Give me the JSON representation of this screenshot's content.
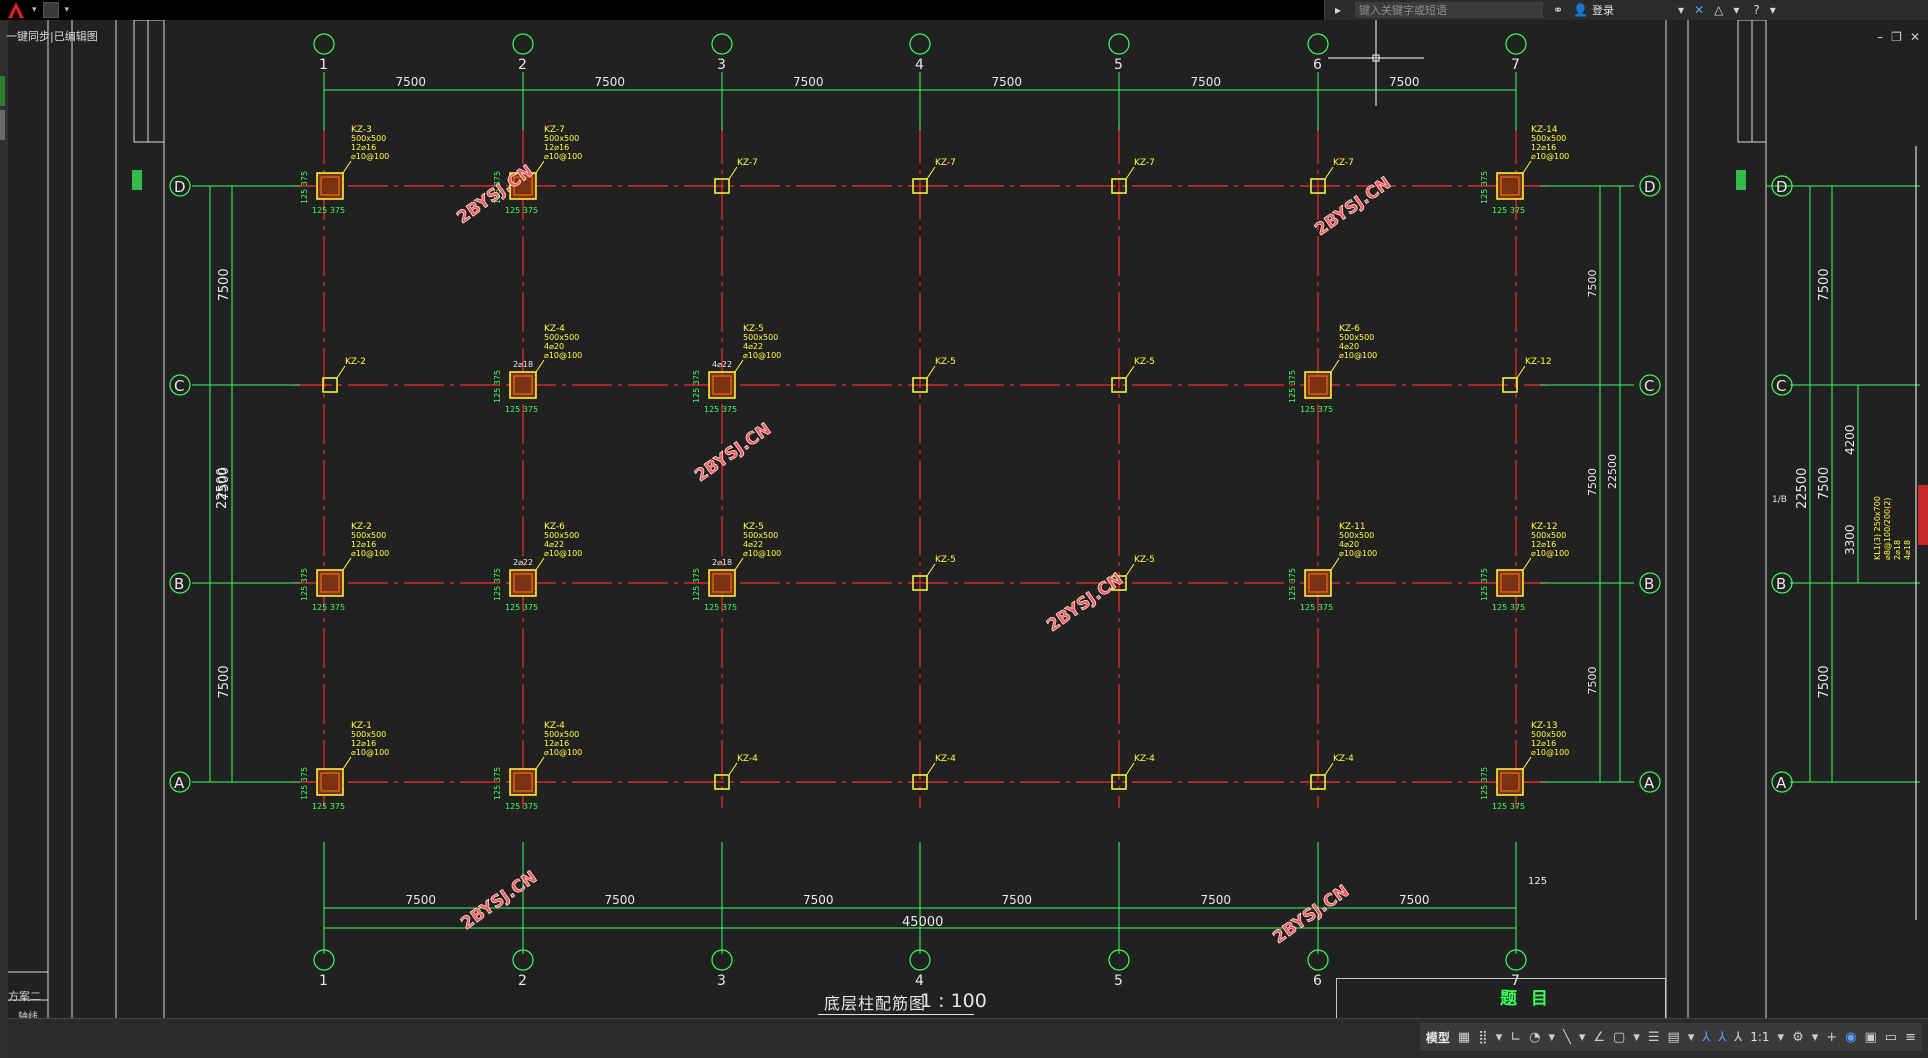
{
  "toolbar": {
    "search_placeholder": "键入关键字或短语",
    "login_label": "登录"
  },
  "hint_text": "一键同步|已编辑图",
  "drawing": {
    "title": "底层柱配筋图",
    "scale": "1 : 100",
    "grid_numbers": [
      "1",
      "2",
      "3",
      "4",
      "5",
      "6",
      "7"
    ],
    "grid_letters": [
      "D",
      "C",
      "B",
      "A"
    ],
    "bay_dims": [
      "7500",
      "7500",
      "7500",
      "7500",
      "7500",
      "7500"
    ],
    "total_width": "45000",
    "left_dims": [
      "7500",
      "7500",
      "7500"
    ],
    "left_total": "22500",
    "right_dims": [
      "7500",
      "7500",
      "7500"
    ],
    "right_total": "22500",
    "dim_125": "125",
    "watermark": "2BYSJ.CN",
    "columns": [
      {
        "label": "KZ-3",
        "spec": [
          "500x500",
          "12⌀16",
          "⌀10@100"
        ]
      },
      {
        "label": "KZ-7",
        "spec": [
          "500x500",
          "12⌀16",
          "⌀10@100"
        ]
      },
      {
        "label": "KZ-7",
        "spec": []
      },
      {
        "label": "KZ-7",
        "spec": []
      },
      {
        "label": "KZ-7",
        "spec": []
      },
      {
        "label": "KZ-7",
        "spec": []
      },
      {
        "label": "KZ-14",
        "spec": [
          "500x500",
          "12⌀16",
          "⌀10@100"
        ]
      },
      {
        "label": "KZ-2",
        "spec": []
      },
      {
        "label": "KZ-4",
        "spec": [
          "500x500",
          "4⌀20",
          "⌀10@100"
        ]
      },
      {
        "label": "KZ-5",
        "spec": [
          "500x500",
          "4⌀22",
          "⌀10@100"
        ]
      },
      {
        "label": "KZ-5",
        "spec": []
      },
      {
        "label": "KZ-5",
        "spec": []
      },
      {
        "label": "KZ-6",
        "spec": [
          "500x500",
          "4⌀20",
          "⌀10@100"
        ]
      },
      {
        "label": "KZ-12",
        "spec": []
      },
      {
        "label": "KZ-2",
        "spec": [
          "500x500",
          "12⌀16",
          "⌀10@100"
        ]
      },
      {
        "label": "KZ-6",
        "spec": [
          "500x500",
          "4⌀22",
          "⌀10@100"
        ]
      },
      {
        "label": "KZ-5",
        "spec": [
          "500x500",
          "4⌀22",
          "⌀10@100"
        ]
      },
      {
        "label": "KZ-5",
        "spec": []
      },
      {
        "label": "KZ-5",
        "spec": []
      },
      {
        "label": "KZ-11",
        "spec": [
          "500x500",
          "4⌀20",
          "⌀10@100"
        ]
      },
      {
        "label": "KZ-12",
        "spec": [
          "500x500",
          "12⌀16",
          "⌀10@100"
        ]
      },
      {
        "label": "KZ-1",
        "spec": [
          "500x500",
          "12⌀16",
          "⌀10@100"
        ]
      },
      {
        "label": "KZ-4",
        "spec": [
          "500x500",
          "12⌀16",
          "⌀10@100"
        ]
      },
      {
        "label": "KZ-4",
        "spec": []
      },
      {
        "label": "KZ-4",
        "spec": []
      },
      {
        "label": "KZ-4",
        "spec": []
      },
      {
        "label": "KZ-4",
        "spec": []
      },
      {
        "label": "KZ-13",
        "spec": [
          "500x500",
          "12⌀16",
          "⌀10@100"
        ]
      }
    ],
    "rebar_small": [
      "2⌀18",
      "4⌀22",
      "2⌀22",
      "2⌀18"
    ],
    "section_dims": "125  375",
    "side_dims": "125  375",
    "right_panel": {
      "dims": [
        "7500",
        "7500",
        "7500"
      ],
      "total": "22500",
      "sub_dims": [
        "4200",
        "3300"
      ],
      "grid_letters": [
        "D",
        "C",
        "B",
        "A"
      ],
      "beam_note": [
        "KL1(3) 250x700",
        "⌀8@100/200(2)",
        "2⌀18",
        "4⌀18"
      ]
    }
  },
  "left_panel": {
    "scheme_label": "方案二",
    "axis_label": "轴线"
  },
  "titleblock": {
    "label": "题 目"
  },
  "statusbar": {
    "model_label": "模型",
    "scale_label": "1:1"
  },
  "colors": {
    "background": "#212121",
    "grid_axis": "#ff2a2a",
    "dimension": "#39ff5c",
    "column": "#ffff3d",
    "watermark": "#ff5a5a"
  }
}
